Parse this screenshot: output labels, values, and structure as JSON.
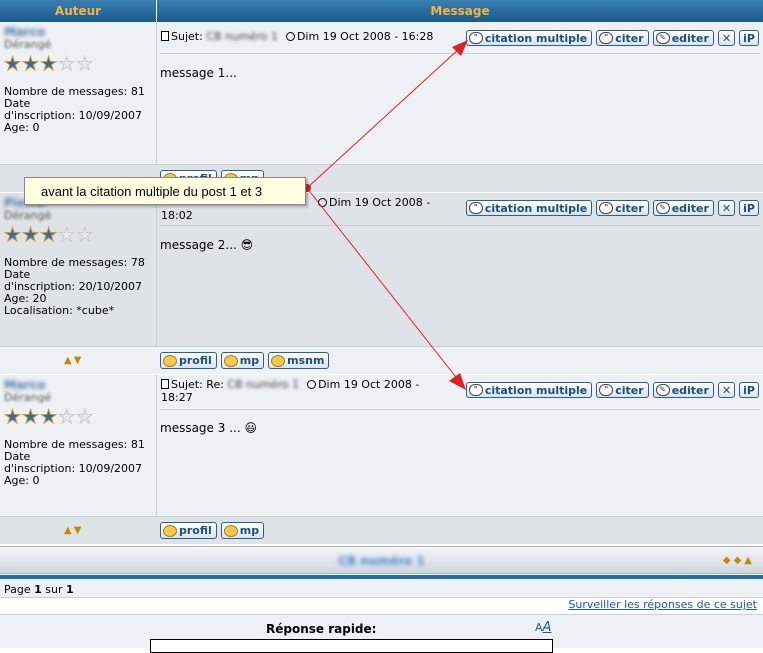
{
  "header": {
    "author_col": "Auteur",
    "message_col": "Message"
  },
  "posts": [
    {
      "username": "Marco",
      "rank": "Dérangé",
      "stars_on": 3,
      "stars_total": 5,
      "meta_lines": [
        "Nombre de messages: 81",
        "Date",
        "d'inscription: 10/09/2007",
        "Age: 0"
      ],
      "subject_label": "Sujet:",
      "subject": "CB numéro 1",
      "date": "Dim 19 Oct 2008 - 16:28",
      "date_cont": "",
      "body": "message 1...",
      "smiley": ""
    },
    {
      "username": "Pierre",
      "rank": "Dérangé",
      "stars_on": 3,
      "stars_total": 5,
      "meta_lines": [
        "Nombre de messages: 78",
        "Date",
        "d'inscription: 20/10/2007",
        "Age: 20",
        "Localisation: *cube*"
      ],
      "subject_label": "",
      "subject": "",
      "date": "Dim 19 Oct 2008 -",
      "date_cont": "18:02",
      "body": "message 2...",
      "smiley": "😎"
    },
    {
      "username": "Marco",
      "rank": "Dérangé",
      "stars_on": 3,
      "stars_total": 5,
      "meta_lines": [
        "Nombre de messages: 81",
        "Date",
        "d'inscription: 10/09/2007",
        "Age: 0"
      ],
      "subject_label": "Sujet: Re:",
      "subject": "CB numéro 1",
      "date": "Dim 19 Oct 2008 -",
      "date_cont": "18:27",
      "body": "message 3 ...",
      "smiley": "😃"
    }
  ],
  "buttons": {
    "multi_quote": "citation multiple",
    "quote": "citer",
    "edit": "editer",
    "delete": "✕",
    "ip": "iP"
  },
  "footer_buttons": {
    "profile": "profil",
    "pm": "mp",
    "msnm": "msnm"
  },
  "thread_title": "CB numéro 1",
  "pagination": {
    "prefix": "Page",
    "current": "1",
    "sep": "sur",
    "total": "1"
  },
  "watch_link": "Surveiller les réponses de ce sujet",
  "quick_reply": {
    "label": "Réponse rapide:",
    "font_icon_a": "A",
    "font_icon_b": "A"
  },
  "tooltip": "avant la citation multiple du post 1 et 3",
  "colors": {
    "header_bg": "#1a5a8c",
    "header_text": "#f7b33f",
    "arrow": "#e02020",
    "link": "#1a5aa8"
  }
}
